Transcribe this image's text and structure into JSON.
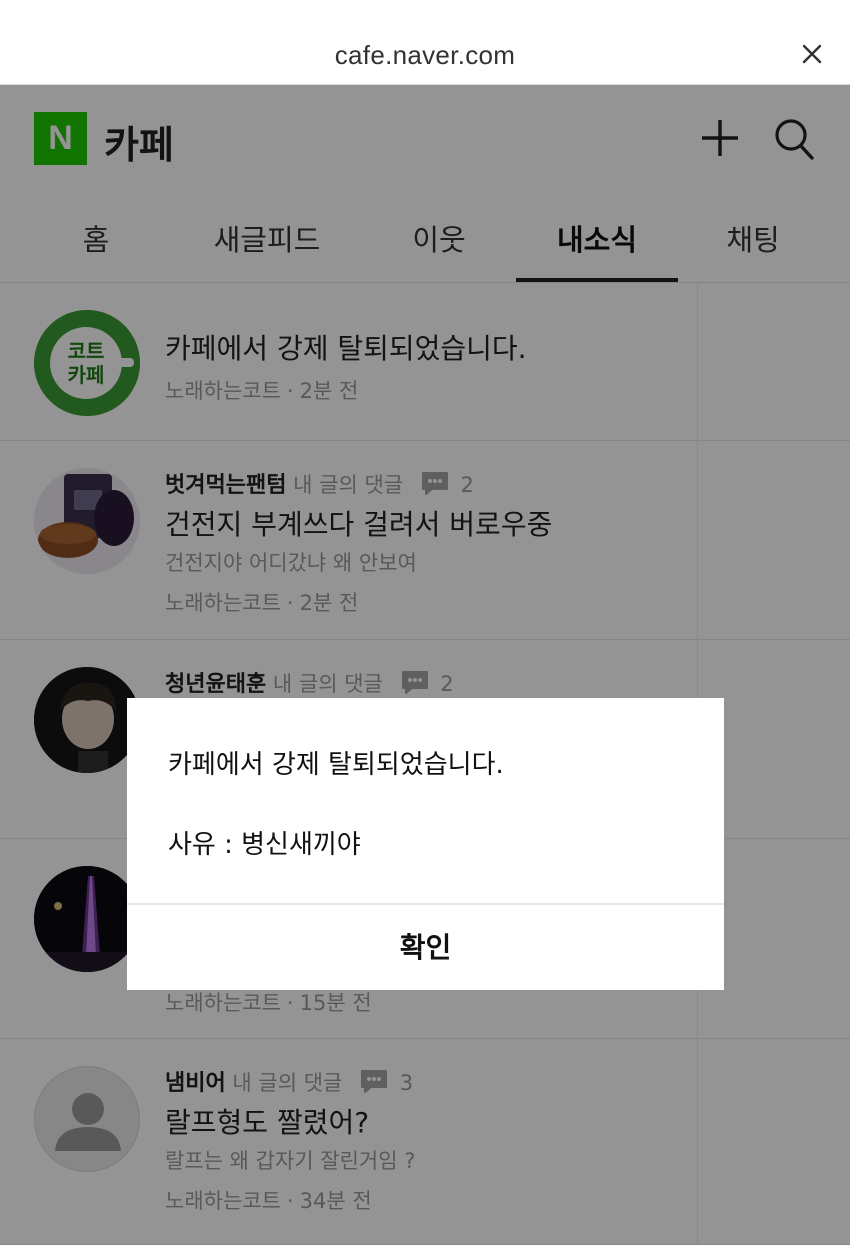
{
  "browser": {
    "url": "cafe.naver.com",
    "close_icon": "close-icon"
  },
  "header": {
    "logo_letter": "N",
    "title": "카페",
    "logo_color": "#1ec800"
  },
  "tabs": [
    {
      "label": "홈",
      "active": false
    },
    {
      "label": "새글피드",
      "active": false
    },
    {
      "label": "이웃",
      "active": false
    },
    {
      "label": "내소식",
      "active": true
    },
    {
      "label": "채팅",
      "active": false
    }
  ],
  "notifications": [
    {
      "title": "카페에서 강제 탈퇴되었습니다.",
      "author": "노래하는코트",
      "time": "2분 전",
      "avatar_text": [
        "코트",
        "카페"
      ]
    },
    {
      "nickname": "벗겨먹는팬텀",
      "type": "내 글의 댓글",
      "comments": "2",
      "title": "건전지 부계쓰다 걸려서 버로우중",
      "snippet": "건전지야 어디갔냐 왜 안보여",
      "author": "노래하는코트",
      "time": "2분 전"
    },
    {
      "nickname": "청년윤태훈",
      "type": "내 글의 댓글",
      "comments": "2"
    },
    {
      "author": "노래하는코트",
      "time": "15분 전"
    },
    {
      "nickname": "냄비어",
      "type": "내 글의 댓글",
      "comments": "3",
      "title": "랄프형도 짤렸어?",
      "snippet": "랄프는 왜 갑자기 잘린거임 ?",
      "author": "노래하는코트",
      "time": "34분 전"
    }
  ],
  "dialog": {
    "message": "카페에서 강제 탈퇴되었습니다.",
    "reason": "사유 : 병신새끼야",
    "confirm_label": "확인"
  }
}
